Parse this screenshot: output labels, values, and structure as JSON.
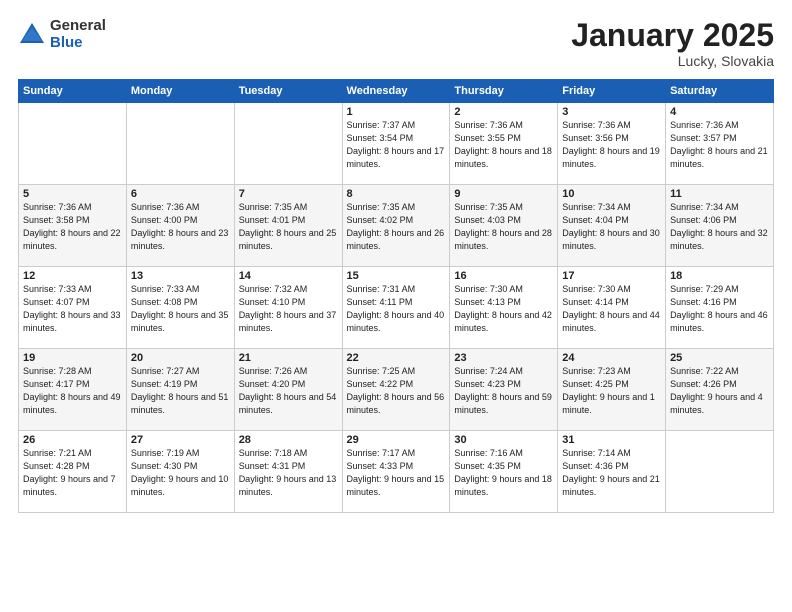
{
  "header": {
    "logo_general": "General",
    "logo_blue": "Blue",
    "title": "January 2025",
    "location": "Lucky, Slovakia"
  },
  "days_of_week": [
    "Sunday",
    "Monday",
    "Tuesday",
    "Wednesday",
    "Thursday",
    "Friday",
    "Saturday"
  ],
  "weeks": [
    [
      {
        "day": "",
        "info": ""
      },
      {
        "day": "",
        "info": ""
      },
      {
        "day": "",
        "info": ""
      },
      {
        "day": "1",
        "info": "Sunrise: 7:37 AM\nSunset: 3:54 PM\nDaylight: 8 hours\nand 17 minutes."
      },
      {
        "day": "2",
        "info": "Sunrise: 7:36 AM\nSunset: 3:55 PM\nDaylight: 8 hours\nand 18 minutes."
      },
      {
        "day": "3",
        "info": "Sunrise: 7:36 AM\nSunset: 3:56 PM\nDaylight: 8 hours\nand 19 minutes."
      },
      {
        "day": "4",
        "info": "Sunrise: 7:36 AM\nSunset: 3:57 PM\nDaylight: 8 hours\nand 21 minutes."
      }
    ],
    [
      {
        "day": "5",
        "info": "Sunrise: 7:36 AM\nSunset: 3:58 PM\nDaylight: 8 hours\nand 22 minutes."
      },
      {
        "day": "6",
        "info": "Sunrise: 7:36 AM\nSunset: 4:00 PM\nDaylight: 8 hours\nand 23 minutes."
      },
      {
        "day": "7",
        "info": "Sunrise: 7:35 AM\nSunset: 4:01 PM\nDaylight: 8 hours\nand 25 minutes."
      },
      {
        "day": "8",
        "info": "Sunrise: 7:35 AM\nSunset: 4:02 PM\nDaylight: 8 hours\nand 26 minutes."
      },
      {
        "day": "9",
        "info": "Sunrise: 7:35 AM\nSunset: 4:03 PM\nDaylight: 8 hours\nand 28 minutes."
      },
      {
        "day": "10",
        "info": "Sunrise: 7:34 AM\nSunset: 4:04 PM\nDaylight: 8 hours\nand 30 minutes."
      },
      {
        "day": "11",
        "info": "Sunrise: 7:34 AM\nSunset: 4:06 PM\nDaylight: 8 hours\nand 32 minutes."
      }
    ],
    [
      {
        "day": "12",
        "info": "Sunrise: 7:33 AM\nSunset: 4:07 PM\nDaylight: 8 hours\nand 33 minutes."
      },
      {
        "day": "13",
        "info": "Sunrise: 7:33 AM\nSunset: 4:08 PM\nDaylight: 8 hours\nand 35 minutes."
      },
      {
        "day": "14",
        "info": "Sunrise: 7:32 AM\nSunset: 4:10 PM\nDaylight: 8 hours\nand 37 minutes."
      },
      {
        "day": "15",
        "info": "Sunrise: 7:31 AM\nSunset: 4:11 PM\nDaylight: 8 hours\nand 40 minutes."
      },
      {
        "day": "16",
        "info": "Sunrise: 7:30 AM\nSunset: 4:13 PM\nDaylight: 8 hours\nand 42 minutes."
      },
      {
        "day": "17",
        "info": "Sunrise: 7:30 AM\nSunset: 4:14 PM\nDaylight: 8 hours\nand 44 minutes."
      },
      {
        "day": "18",
        "info": "Sunrise: 7:29 AM\nSunset: 4:16 PM\nDaylight: 8 hours\nand 46 minutes."
      }
    ],
    [
      {
        "day": "19",
        "info": "Sunrise: 7:28 AM\nSunset: 4:17 PM\nDaylight: 8 hours\nand 49 minutes."
      },
      {
        "day": "20",
        "info": "Sunrise: 7:27 AM\nSunset: 4:19 PM\nDaylight: 8 hours\nand 51 minutes."
      },
      {
        "day": "21",
        "info": "Sunrise: 7:26 AM\nSunset: 4:20 PM\nDaylight: 8 hours\nand 54 minutes."
      },
      {
        "day": "22",
        "info": "Sunrise: 7:25 AM\nSunset: 4:22 PM\nDaylight: 8 hours\nand 56 minutes."
      },
      {
        "day": "23",
        "info": "Sunrise: 7:24 AM\nSunset: 4:23 PM\nDaylight: 8 hours\nand 59 minutes."
      },
      {
        "day": "24",
        "info": "Sunrise: 7:23 AM\nSunset: 4:25 PM\nDaylight: 9 hours\nand 1 minute."
      },
      {
        "day": "25",
        "info": "Sunrise: 7:22 AM\nSunset: 4:26 PM\nDaylight: 9 hours\nand 4 minutes."
      }
    ],
    [
      {
        "day": "26",
        "info": "Sunrise: 7:21 AM\nSunset: 4:28 PM\nDaylight: 9 hours\nand 7 minutes."
      },
      {
        "day": "27",
        "info": "Sunrise: 7:19 AM\nSunset: 4:30 PM\nDaylight: 9 hours\nand 10 minutes."
      },
      {
        "day": "28",
        "info": "Sunrise: 7:18 AM\nSunset: 4:31 PM\nDaylight: 9 hours\nand 13 minutes."
      },
      {
        "day": "29",
        "info": "Sunrise: 7:17 AM\nSunset: 4:33 PM\nDaylight: 9 hours\nand 15 minutes."
      },
      {
        "day": "30",
        "info": "Sunrise: 7:16 AM\nSunset: 4:35 PM\nDaylight: 9 hours\nand 18 minutes."
      },
      {
        "day": "31",
        "info": "Sunrise: 7:14 AM\nSunset: 4:36 PM\nDaylight: 9 hours\nand 21 minutes."
      },
      {
        "day": "",
        "info": ""
      }
    ]
  ]
}
